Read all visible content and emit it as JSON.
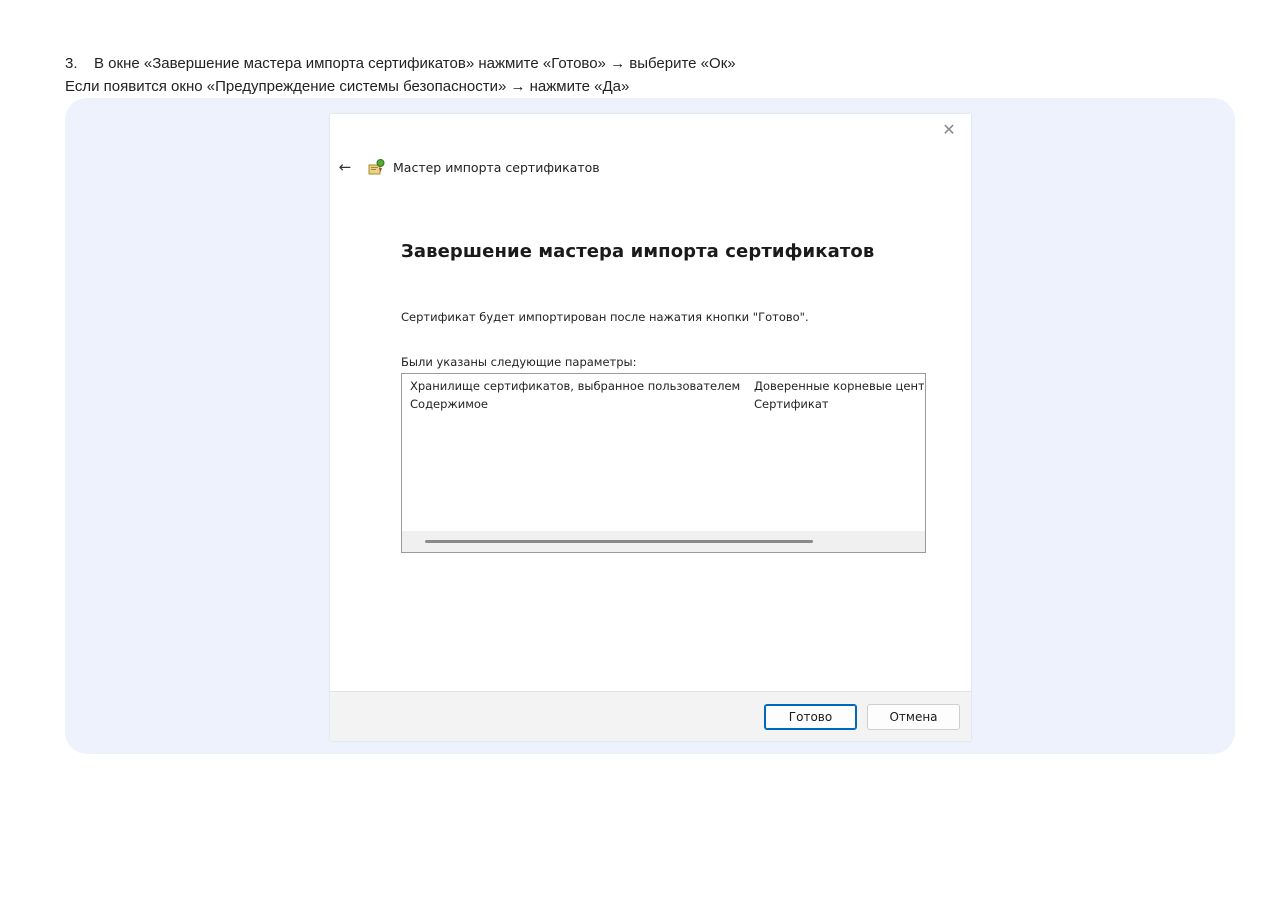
{
  "instructions": {
    "step_number": "3.",
    "step_text": "В окне «Завершение мастера импорта сертификатов» нажмите «Готово» → выберите «Ок»",
    "note_text": "Если появится окно «Предупреждение системы безопасности» → нажмите «Да»"
  },
  "dialog": {
    "close_glyph": "✕",
    "back_glyph": "←",
    "window_title": "Мастер импорта сертификатов",
    "heading": "Завершение мастера импорта сертификатов",
    "info_text": "Сертификат будет импортирован после нажатия кнопки \"Готово\".",
    "params_label": "Были указаны следующие параметры:",
    "params": [
      {
        "name": "Хранилище сертификатов, выбранное пользователем",
        "value": "Доверенные корневые центры сертификации"
      },
      {
        "name": "Содержимое",
        "value": "Сертификат"
      }
    ],
    "finish_label": "Готово",
    "cancel_label": "Отмена"
  },
  "colors": {
    "panel_bg": "#edf2fc",
    "accent": "#0067c0"
  },
  "icons": {
    "wizard": "certificate-wizard-icon",
    "back": "back-arrow-icon",
    "close": "close-icon"
  }
}
